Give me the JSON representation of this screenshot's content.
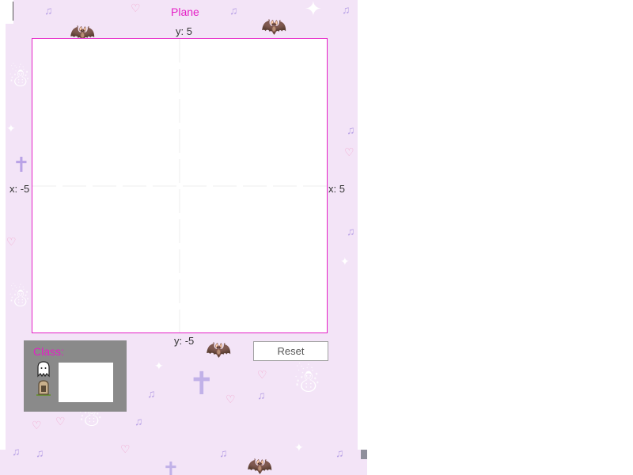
{
  "plane": {
    "title": "Plane"
  },
  "axes": {
    "y_max_label": "y: 5",
    "y_min_label": "y: -5",
    "x_min_label": "x: -5",
    "x_max_label": "x: 5"
  },
  "controls": {
    "reset_label": "Reset"
  },
  "class_panel": {
    "label": "Class:",
    "options": [
      "ghost-icon",
      "tombstone-icon"
    ]
  },
  "colors": {
    "accent": "#e41fc6",
    "background": "#f3e4f7",
    "panel": "#8a8a8a",
    "decor": "#b9a2e6"
  }
}
